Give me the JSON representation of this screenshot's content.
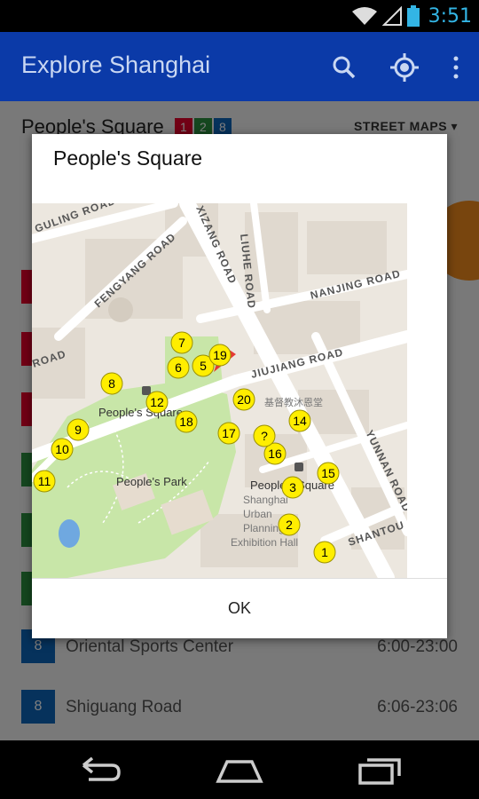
{
  "status_bar": {
    "time": "3:51"
  },
  "app_bar": {
    "title": "Explore Shanghai",
    "icons": [
      "search-icon",
      "my-location-icon",
      "overflow-menu-icon"
    ]
  },
  "station": {
    "name": "People's Square",
    "lines": [
      {
        "label": "1",
        "color": "#e4002b"
      },
      {
        "label": "2",
        "color": "#2b8e3e"
      },
      {
        "label": "8",
        "color": "#0c64b8"
      }
    ],
    "street_maps_label": "STREET MAPS"
  },
  "list_rows": [
    {
      "badge": "8",
      "color": "#0c64b8",
      "name": "Oriental Sports Center",
      "time": "6:00-23:00"
    },
    {
      "badge": "8",
      "color": "#0c64b8",
      "name": "Shiguang Road",
      "time": "6:06-23:06"
    }
  ],
  "dialog": {
    "title": "People's Square",
    "ok_label": "OK",
    "map": {
      "street_labels": [
        "GULING ROAD",
        "FENGYANG ROAD",
        "XIZANG ROAD",
        "LIUHE ROAD",
        "NANJING ROAD",
        "JIUJIANG ROAD",
        "YUNNAN ROAD",
        "SHANTOU",
        "ROAD"
      ],
      "place_labels": [
        "People's Square",
        "People's Park",
        "People's Square",
        "Shanghai Urban Planning Exhibition Hall",
        "基督教沐恩堂"
      ],
      "exit_markers": [
        "1",
        "2",
        "3",
        "5",
        "6",
        "7",
        "8",
        "9",
        "10",
        "11",
        "12",
        "14",
        "15",
        "16",
        "17",
        "18",
        "19",
        "20",
        "?"
      ]
    }
  },
  "colors": {
    "app_bar": "#0b3aa8",
    "marker": "#ffee00",
    "park": "#c8e6a8",
    "pin": "#e53935"
  }
}
